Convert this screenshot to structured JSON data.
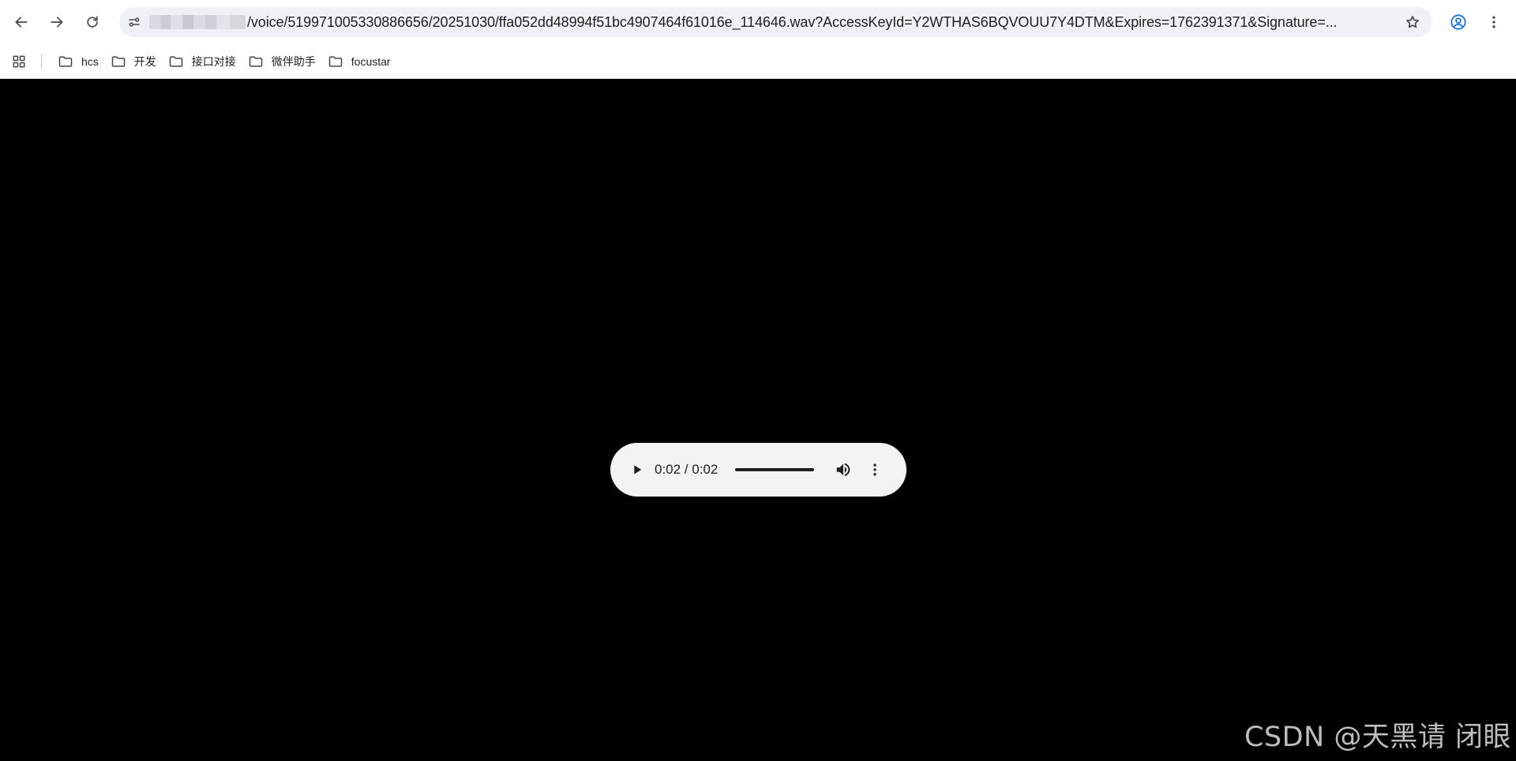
{
  "browser": {
    "url": "/voice/519971005330886656/20251030/ffa052dd48994f51bc4907464f61016e_114646.wav?AccessKeyId=Y2WTHAS6BQVOUU7Y4DTM&Expires=1762391371&Signature=...",
    "icons": {
      "back": "arrow-left-icon",
      "forward": "arrow-right-icon",
      "reload": "reload-icon",
      "site_info": "tune-icon",
      "bookmark": "star-outline-icon",
      "profile": "account-circle-icon",
      "menu": "more-vertical-icon",
      "apps": "apps-grid-icon",
      "folder": "folder-icon"
    }
  },
  "bookmarks": {
    "items": [
      {
        "label": "hcs"
      },
      {
        "label": "开发"
      },
      {
        "label": "接口对接"
      },
      {
        "label": "微伴助手"
      },
      {
        "label": "focustar"
      }
    ]
  },
  "player": {
    "time_display": "0:02 / 0:02",
    "progress": 1.0,
    "icons": {
      "play": "play-icon",
      "volume": "volume-icon",
      "more": "more-vertical-icon"
    }
  },
  "watermark": "CSDN @天黑请 闭眼"
}
